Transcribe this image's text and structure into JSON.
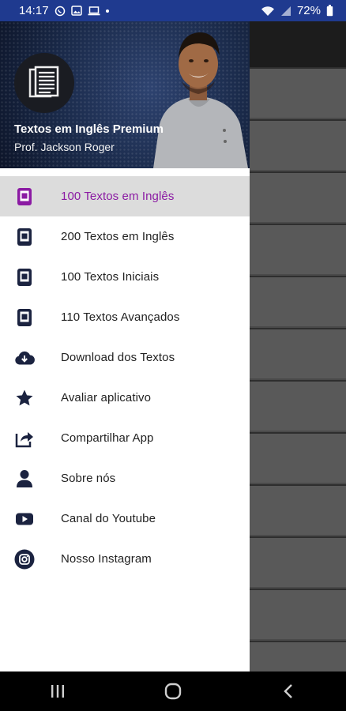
{
  "status_bar": {
    "time": "14:17",
    "battery_percent": "72%",
    "icons_left": [
      "whatsapp-icon",
      "image-icon",
      "laptop-icon",
      "dot-icon"
    ],
    "icons_right": [
      "wifi-icon",
      "signal-icon",
      "battery-icon"
    ]
  },
  "drawer": {
    "header": {
      "title": "Textos em Inglês Premium",
      "subtitle": "Prof. Jackson Roger",
      "avatar_icon": "document-icon"
    },
    "items": [
      {
        "label": "100 Textos em Inglês",
        "icon": "book-icon",
        "active": true
      },
      {
        "label": "200 Textos em Inglês",
        "icon": "book-icon",
        "active": false
      },
      {
        "label": "100 Textos Iniciais",
        "icon": "book-icon",
        "active": false
      },
      {
        "label": "110 Textos Avançados",
        "icon": "book-icon",
        "active": false
      },
      {
        "label": "Download dos Textos",
        "icon": "cloud-download-icon",
        "active": false
      },
      {
        "label": "Avaliar aplicativo",
        "icon": "star-icon",
        "active": false
      },
      {
        "label": "Compartilhar App",
        "icon": "share-icon",
        "active": false
      },
      {
        "label": "Sobre nós",
        "icon": "user-icon",
        "active": false
      },
      {
        "label": "Canal do Youtube",
        "icon": "youtube-icon",
        "active": false
      },
      {
        "label": "Nosso Instagram",
        "icon": "instagram-icon",
        "active": false
      }
    ]
  },
  "nav_bar": {
    "buttons": [
      "recents-icon",
      "home-icon",
      "back-icon"
    ]
  },
  "colors": {
    "status_bar": "#1f3a8f",
    "active_text": "#8b1aa3",
    "icon": "#1b2340",
    "active_background": "#dcdcdc"
  }
}
